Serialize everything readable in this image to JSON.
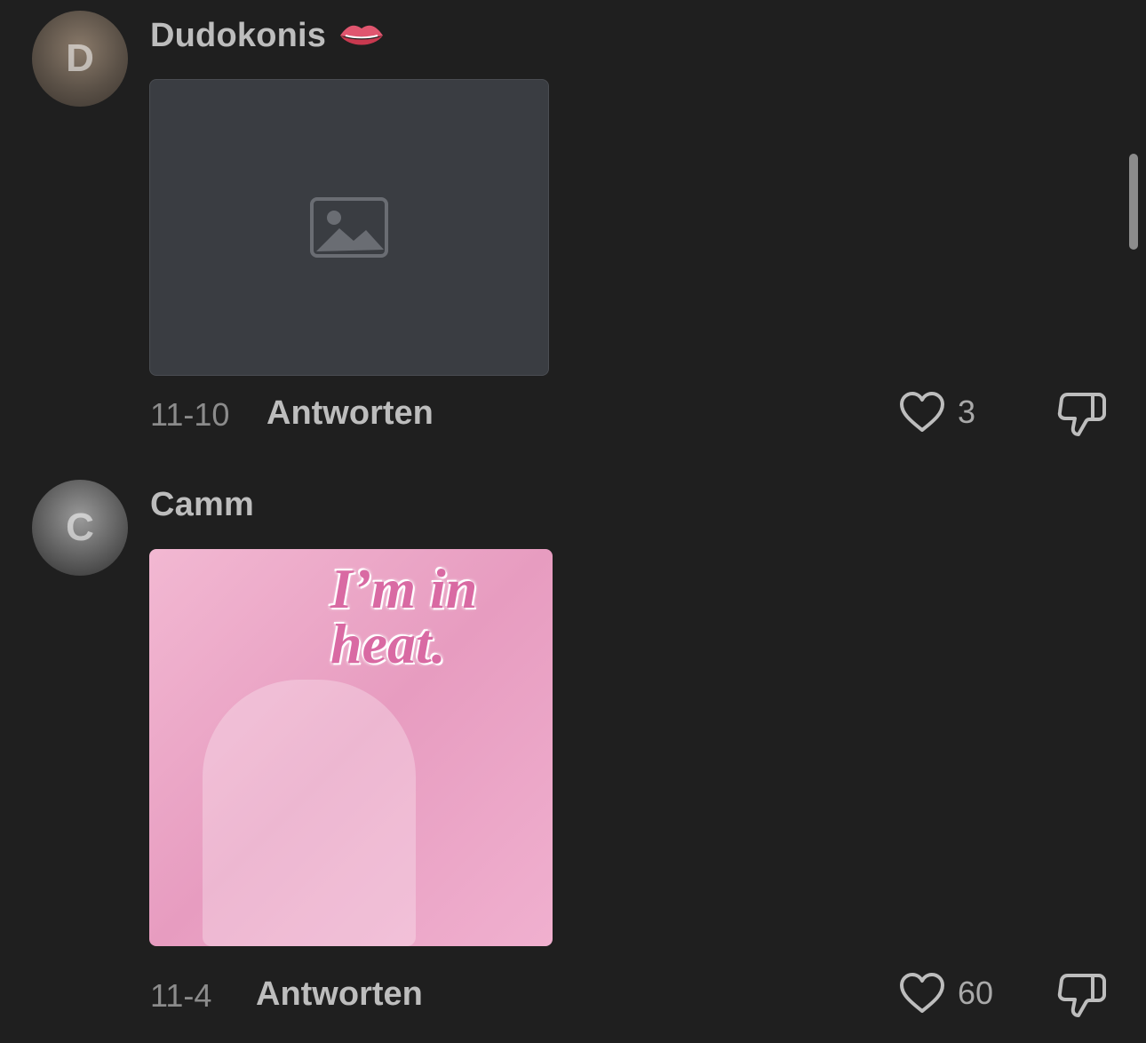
{
  "comments": [
    {
      "username": "Dudokonis",
      "username_emoji": "lips-icon",
      "avatar_initial": "D",
      "media": {
        "kind": "photo",
        "caption": ""
      },
      "timestamp": "11-10",
      "reply_label": "Antworten",
      "like_count": "3"
    },
    {
      "username": "Camm",
      "avatar_initial": "C",
      "media": {
        "kind": "meme",
        "caption": "I’m in heat."
      },
      "timestamp": "11-4",
      "reply_label": "Antworten",
      "like_count": "60"
    }
  ],
  "colors": {
    "background": "#1f1f1f",
    "text_primary": "#bdbdbd",
    "text_secondary": "#8b8b8b",
    "lips": "#e0566f",
    "meme_pink": "#e79cc0"
  }
}
